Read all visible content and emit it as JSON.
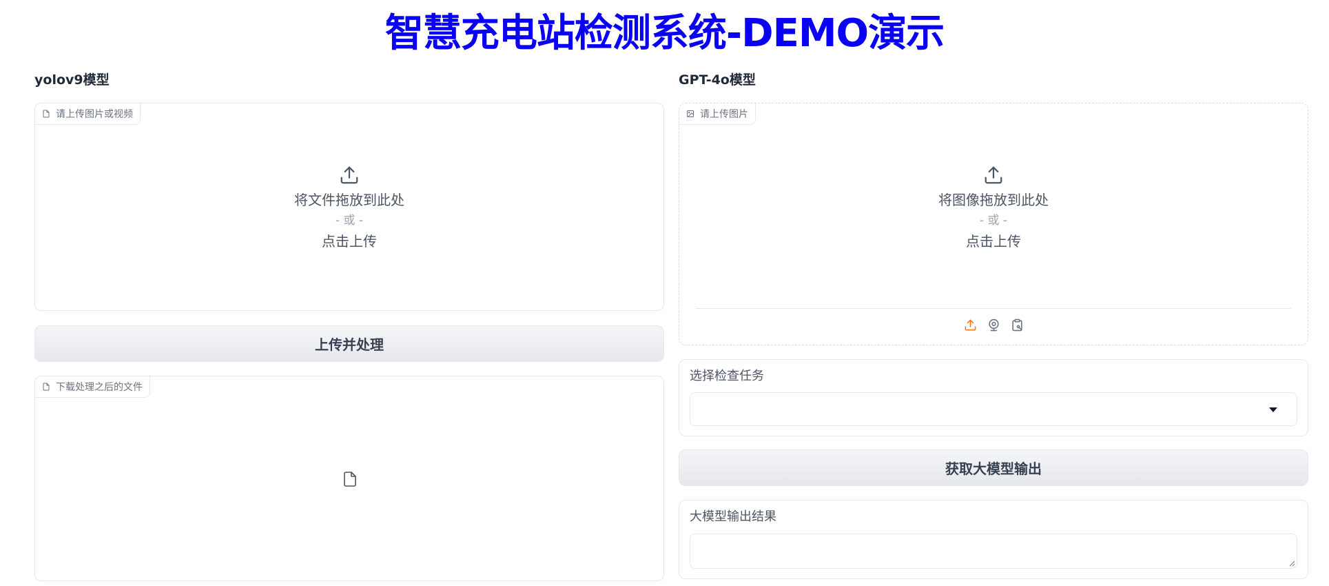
{
  "page": {
    "title": "智慧充电站检测系统-DEMO演示"
  },
  "left": {
    "label": "yolov9模型",
    "upload": {
      "tag": "请上传图片或视频",
      "drop_text": "将文件拖放到此处",
      "or_text": "- 或 -",
      "click_text": "点击上传"
    },
    "process_button": "上传并处理",
    "download": {
      "tag": "下载处理之后的文件"
    }
  },
  "right": {
    "label": "GPT-4o模型",
    "upload": {
      "tag": "请上传图片",
      "drop_text": "将图像拖放到此处",
      "or_text": "- 或 -",
      "click_text": "点击上传"
    },
    "task": {
      "label": "选择检查任务",
      "value": ""
    },
    "get_button": "获取大模型输出",
    "output": {
      "label": "大模型输出结果",
      "value": ""
    }
  },
  "colors": {
    "title": "#0a00f5",
    "accent_upload_icon": "#f97316",
    "border": "#e5e7eb"
  },
  "icons": {
    "file": "file-icon",
    "image": "image-icon",
    "upload": "upload-icon",
    "webcam": "webcam-icon",
    "clipboard": "clipboard-icon"
  }
}
